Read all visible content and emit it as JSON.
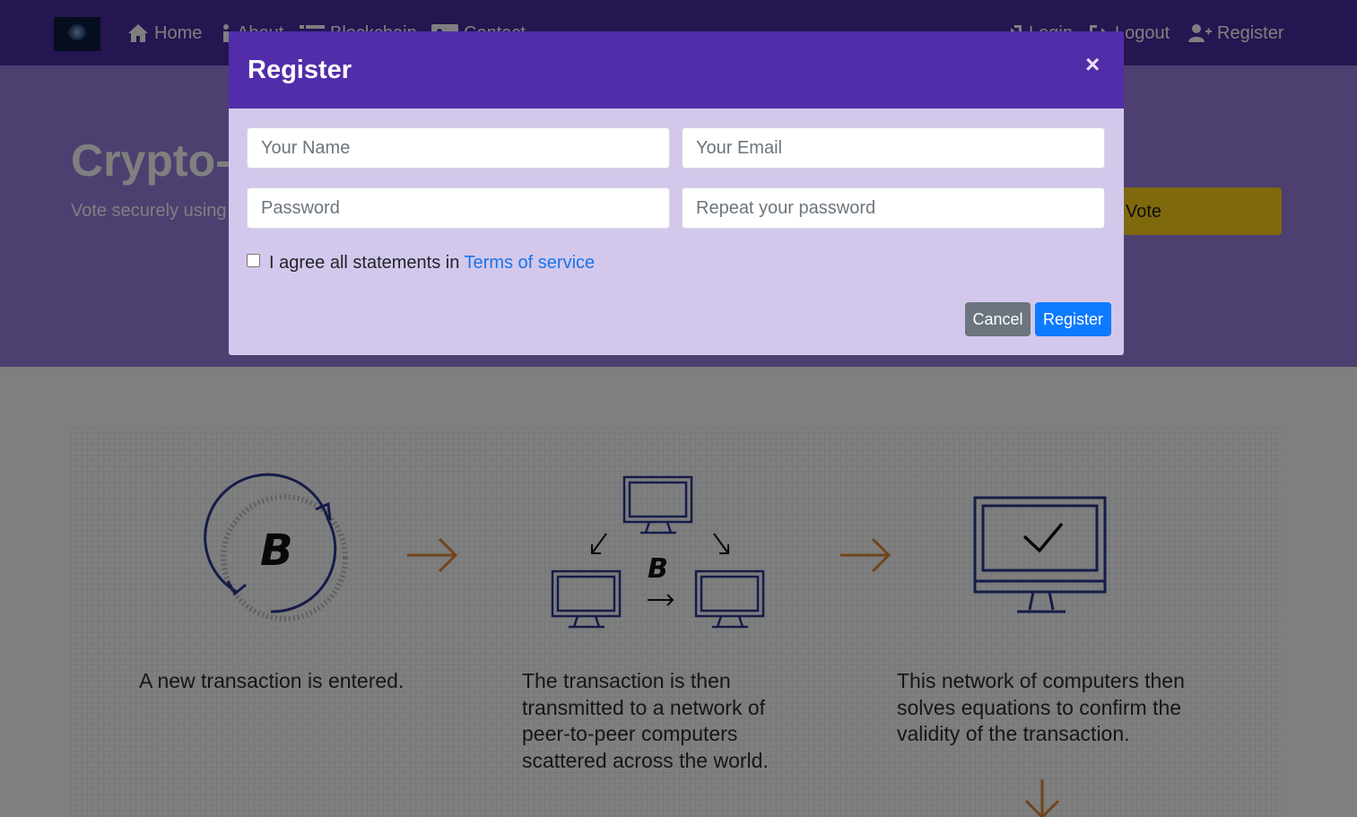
{
  "nav": {
    "home": "Home",
    "about": "About",
    "blockchain": "Blockchain",
    "contact": "Contact",
    "login": "Login",
    "logout": "Logout",
    "register": "Register"
  },
  "hero": {
    "title": "Crypto-",
    "subtitle": "Vote securely using",
    "vote_button": "Vote"
  },
  "carousel": {
    "steps": [
      "A new transaction is entered.",
      "The transaction is then transmitted to a network of peer-to-peer computers scattered across the world.",
      "This network of computers then solves equations to confirm the validity of the transaction."
    ]
  },
  "modal": {
    "title": "Register",
    "close_symbol": "×",
    "name_placeholder": "Your Name",
    "email_placeholder": "Your Email",
    "password_placeholder": "Password",
    "repeat_password_placeholder": "Repeat your password",
    "agree_text": "I agree all statements in",
    "terms_link": "Terms of service",
    "cancel_button": "Cancel",
    "register_button": "Register"
  },
  "colors": {
    "navbar": "#4b2aa3",
    "hero": "#9b7fe0",
    "modal_header": "#512daa",
    "modal_body": "#d3c8ec",
    "vote_button": "#ffd21a",
    "register_button": "#0d7bff",
    "cancel_button": "#6c757d"
  },
  "icons": {
    "home": "home-icon",
    "about": "info-icon",
    "blockchain": "list-icon",
    "contact": "id-card-icon",
    "login": "sign-in-icon",
    "logout": "sign-out-icon",
    "register": "user-plus-icon",
    "close": "close-icon"
  }
}
